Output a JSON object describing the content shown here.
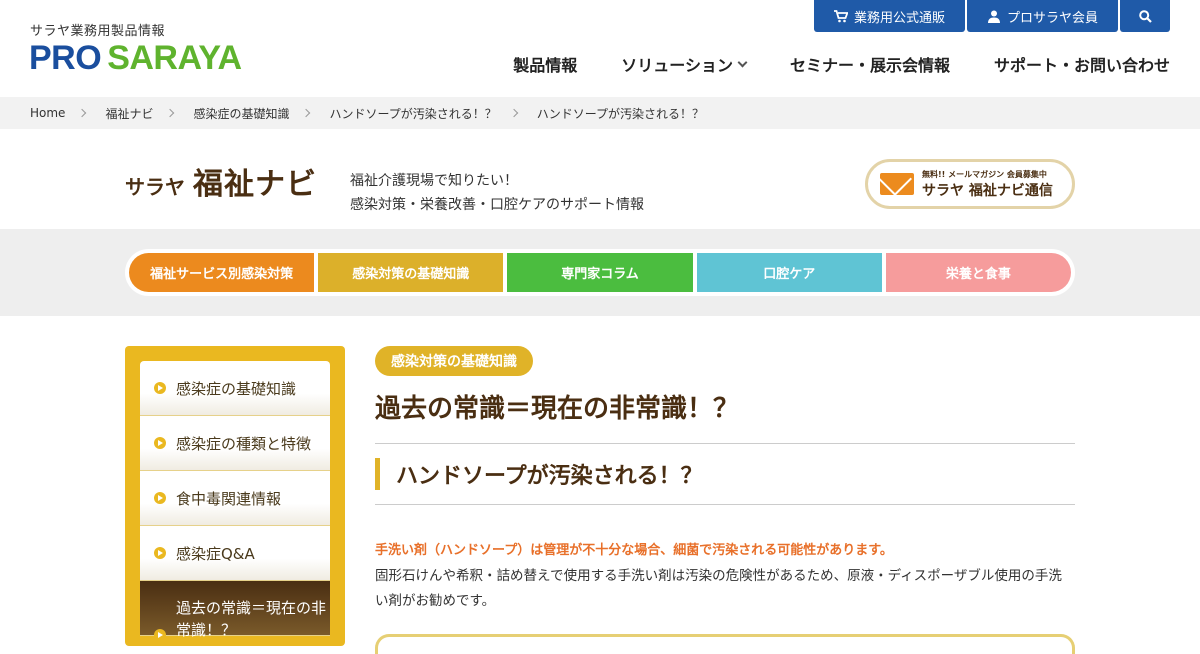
{
  "header": {
    "logo_sub": "サラヤ業務用製品情報",
    "logo_pro": "PRO",
    "logo_saraya": "SARAYA",
    "top_buttons": [
      {
        "label": "業務用公式通販",
        "icon": "cart-icon"
      },
      {
        "label": "プロサラヤ会員",
        "icon": "user-icon"
      },
      {
        "label": "",
        "icon": "search-icon"
      }
    ],
    "nav": [
      "製品情報",
      "ソリューション",
      "セミナー・展示会情報",
      "サポート・お問い合わせ"
    ]
  },
  "breadcrumb": [
    "Home",
    "福祉ナビ",
    "感染症の基礎知識",
    "ハンドソープが汚染される！？",
    "ハンドソープが汚染される！？"
  ],
  "brand": {
    "logo_small": "サラヤ",
    "logo_big": "福祉ナビ",
    "tagline_1": "福祉介護現場で知りたい！",
    "tagline_2": "感染対策・栄養改善・口腔ケアのサポート情報",
    "mailmag_small": "無料!! メールマガジン 会員募集中",
    "mailmag_big": "サラヤ 福祉ナビ通信"
  },
  "categories": [
    {
      "label": "福祉サービス別感染対策",
      "color": "#ec8a1e"
    },
    {
      "label": "感染対策の基礎知識",
      "color": "#dcb02a"
    },
    {
      "label": "専門家コラム",
      "color": "#4bbd3f"
    },
    {
      "label": "口腔ケア",
      "color": "#5fc4d4"
    },
    {
      "label": "栄養と食事",
      "color": "#f69c9c"
    }
  ],
  "sidebar": [
    "感染症の基礎知識",
    "感染症の種類と特徴",
    "食中毒関連情報",
    "感染症Q&A",
    "過去の常識＝現在の非常識！？"
  ],
  "article": {
    "badge": "感染対策の基礎知識",
    "title": "過去の常識＝現在の非常識！？",
    "heading": "ハンドソープが汚染される！？",
    "lead": "手洗い剤（ハンドソープ）は管理が不十分な場合、細菌で汚染される可能性があります。",
    "body": "固形石けんや希釈・詰め替えで使用する手洗い剤は汚染の危険性があるため、原液・ディスポーザブル使用の手洗い剤がお勧めです。"
  }
}
